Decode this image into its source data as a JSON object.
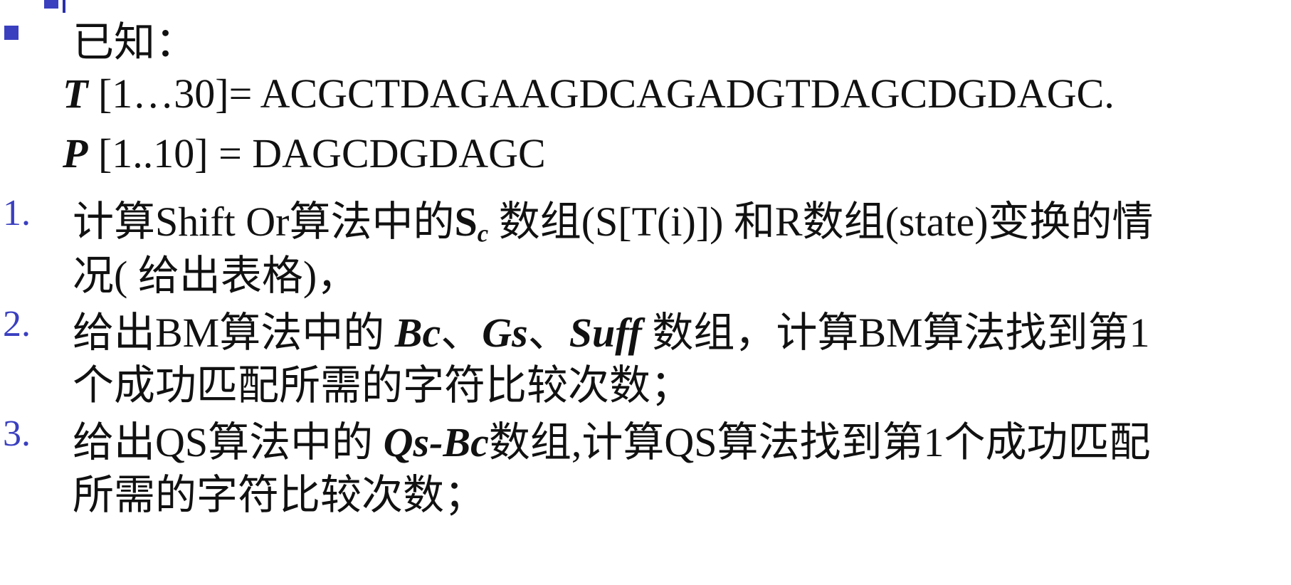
{
  "intro": {
    "label": "已知："
  },
  "given": {
    "t_var": "T",
    "t_range": " [1…30]= ",
    "t_value": "ACGCTDAGAAGDCAGADGTDAGCDGDAGC.",
    "p_var": "P",
    "p_range": " [1..10] = ",
    "p_value": "DAGCDGDAGC"
  },
  "items": [
    {
      "number": "1.",
      "line1_a": "计算Shift Or算法中的",
      "line1_s": "S",
      "line1_sub": "c",
      "line1_b": " 数组(S[T(i)]) 和R数组(state)变换的情",
      "line2": "况( 给出表格)，"
    },
    {
      "number": "2.",
      "line1_a": "给出BM算法中的 ",
      "bc": "Bc",
      "sep1": "、",
      "gs": "Gs",
      "sep2": "、",
      "suff": "Suff",
      "line1_b": " 数组，计算BM算法找到第1",
      "line2": "个成功匹配所需的字符比较次数；"
    },
    {
      "number": "3.",
      "line1_a": "给出QS算法中的 ",
      "qsbc": "Qs-Bc",
      "line1_b": "数组,计算QS算法找到第1个成功匹配",
      "line2": "所需的字符比较次数；"
    }
  ],
  "colors": {
    "accent": "#3a3fc0",
    "text": "#111111",
    "background": "#ffffff"
  }
}
